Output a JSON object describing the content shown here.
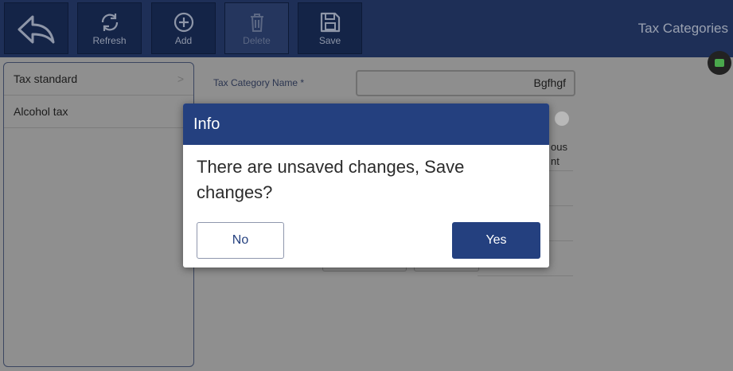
{
  "toolbar": {
    "back_icon": "back-arrow-icon",
    "refresh_label": "Refresh",
    "add_label": "Add",
    "delete_label": "Delete",
    "save_label": "Save"
  },
  "header": {
    "title": "Tax Categories"
  },
  "sidebar": {
    "items": [
      {
        "label": "Tax standard"
      },
      {
        "label": "Alcohol tax"
      }
    ]
  },
  "form": {
    "name_label": "Tax Category Name *",
    "name_value": "Bgfhgf",
    "partial_text_1": "ous",
    "partial_text_2": "nt"
  },
  "dialog": {
    "title": "Info",
    "message": "There are unsaved changes, Save changes?",
    "no_label": "No",
    "yes_label": "Yes"
  },
  "colors": {
    "header_bg": "#1e2f57",
    "dialog_accent": "#24407f",
    "status_indicator": "#4aa84c"
  }
}
